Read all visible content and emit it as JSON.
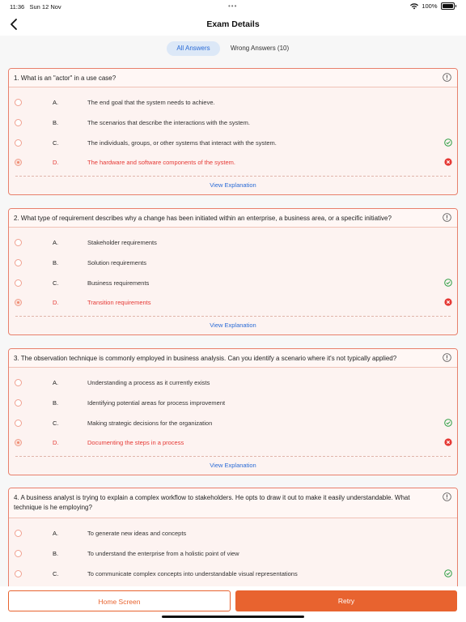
{
  "status": {
    "time": "11:36",
    "date": "Sun 12 Nov",
    "dots": "•••",
    "battery": "100%"
  },
  "nav": {
    "title": "Exam Details"
  },
  "tabs": {
    "all": "All Answers",
    "wrong": "Wrong Answers (10)"
  },
  "explain_label": "View Explanation",
  "questions": [
    {
      "text": "1. What is an \"actor\" in a use case?",
      "options": [
        {
          "letter": "A.",
          "text": "The end goal that the system needs to achieve."
        },
        {
          "letter": "B.",
          "text": "The scenarios that describe the interactions with the system."
        },
        {
          "letter": "C.",
          "text": "The individuals, groups, or other systems that interact with the system."
        },
        {
          "letter": "D.",
          "text": "The hardware and software components of the system."
        }
      ]
    },
    {
      "text": "2. What type of requirement describes why a change has been initiated within an enterprise, a business area, or a specific initiative?",
      "options": [
        {
          "letter": "A.",
          "text": "Stakeholder requirements"
        },
        {
          "letter": "B.",
          "text": "Solution requirements"
        },
        {
          "letter": "C.",
          "text": "Business requirements"
        },
        {
          "letter": "D.",
          "text": "Transition requirements"
        }
      ]
    },
    {
      "text": "3. The observation technique is commonly employed in business analysis. Can you identify a scenario where it's not typically applied?",
      "options": [
        {
          "letter": "A.",
          "text": "Understanding a process as it currently exists"
        },
        {
          "letter": "B.",
          "text": "Identifying potential areas for process improvement"
        },
        {
          "letter": "C.",
          "text": "Making strategic decisions for the organization"
        },
        {
          "letter": "D.",
          "text": "Documenting the steps in a process"
        }
      ]
    },
    {
      "text": "4. A business analyst is trying to explain a complex workflow to stakeholders. He opts to draw it out to make it easily understandable. What technique is he employing?",
      "options": [
        {
          "letter": "A.",
          "text": "To generate new ideas and concepts"
        },
        {
          "letter": "B.",
          "text": "To understand the enterprise from a holistic point of view"
        },
        {
          "letter": "C.",
          "text": "To communicate complex concepts into understandable visual representations"
        }
      ]
    }
  ],
  "buttons": {
    "home": "Home Screen",
    "retry": "Retry"
  },
  "colors": {
    "accent": "#e8632f",
    "correct": "#2e9e44",
    "wrong": "#e53935",
    "link": "#2a6bd6"
  }
}
